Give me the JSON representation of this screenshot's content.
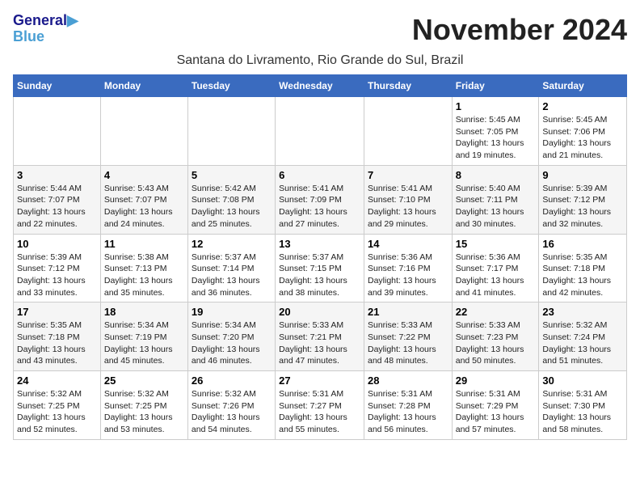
{
  "header": {
    "logo_line1": "General",
    "logo_line2": "Blue",
    "month_title": "November 2024",
    "location": "Santana do Livramento, Rio Grande do Sul, Brazil"
  },
  "weekdays": [
    "Sunday",
    "Monday",
    "Tuesday",
    "Wednesday",
    "Thursday",
    "Friday",
    "Saturday"
  ],
  "weeks": [
    [
      {
        "day": "",
        "info": ""
      },
      {
        "day": "",
        "info": ""
      },
      {
        "day": "",
        "info": ""
      },
      {
        "day": "",
        "info": ""
      },
      {
        "day": "",
        "info": ""
      },
      {
        "day": "1",
        "info": "Sunrise: 5:45 AM\nSunset: 7:05 PM\nDaylight: 13 hours\nand 19 minutes."
      },
      {
        "day": "2",
        "info": "Sunrise: 5:45 AM\nSunset: 7:06 PM\nDaylight: 13 hours\nand 21 minutes."
      }
    ],
    [
      {
        "day": "3",
        "info": "Sunrise: 5:44 AM\nSunset: 7:07 PM\nDaylight: 13 hours\nand 22 minutes."
      },
      {
        "day": "4",
        "info": "Sunrise: 5:43 AM\nSunset: 7:07 PM\nDaylight: 13 hours\nand 24 minutes."
      },
      {
        "day": "5",
        "info": "Sunrise: 5:42 AM\nSunset: 7:08 PM\nDaylight: 13 hours\nand 25 minutes."
      },
      {
        "day": "6",
        "info": "Sunrise: 5:41 AM\nSunset: 7:09 PM\nDaylight: 13 hours\nand 27 minutes."
      },
      {
        "day": "7",
        "info": "Sunrise: 5:41 AM\nSunset: 7:10 PM\nDaylight: 13 hours\nand 29 minutes."
      },
      {
        "day": "8",
        "info": "Sunrise: 5:40 AM\nSunset: 7:11 PM\nDaylight: 13 hours\nand 30 minutes."
      },
      {
        "day": "9",
        "info": "Sunrise: 5:39 AM\nSunset: 7:12 PM\nDaylight: 13 hours\nand 32 minutes."
      }
    ],
    [
      {
        "day": "10",
        "info": "Sunrise: 5:39 AM\nSunset: 7:12 PM\nDaylight: 13 hours\nand 33 minutes."
      },
      {
        "day": "11",
        "info": "Sunrise: 5:38 AM\nSunset: 7:13 PM\nDaylight: 13 hours\nand 35 minutes."
      },
      {
        "day": "12",
        "info": "Sunrise: 5:37 AM\nSunset: 7:14 PM\nDaylight: 13 hours\nand 36 minutes."
      },
      {
        "day": "13",
        "info": "Sunrise: 5:37 AM\nSunset: 7:15 PM\nDaylight: 13 hours\nand 38 minutes."
      },
      {
        "day": "14",
        "info": "Sunrise: 5:36 AM\nSunset: 7:16 PM\nDaylight: 13 hours\nand 39 minutes."
      },
      {
        "day": "15",
        "info": "Sunrise: 5:36 AM\nSunset: 7:17 PM\nDaylight: 13 hours\nand 41 minutes."
      },
      {
        "day": "16",
        "info": "Sunrise: 5:35 AM\nSunset: 7:18 PM\nDaylight: 13 hours\nand 42 minutes."
      }
    ],
    [
      {
        "day": "17",
        "info": "Sunrise: 5:35 AM\nSunset: 7:18 PM\nDaylight: 13 hours\nand 43 minutes."
      },
      {
        "day": "18",
        "info": "Sunrise: 5:34 AM\nSunset: 7:19 PM\nDaylight: 13 hours\nand 45 minutes."
      },
      {
        "day": "19",
        "info": "Sunrise: 5:34 AM\nSunset: 7:20 PM\nDaylight: 13 hours\nand 46 minutes."
      },
      {
        "day": "20",
        "info": "Sunrise: 5:33 AM\nSunset: 7:21 PM\nDaylight: 13 hours\nand 47 minutes."
      },
      {
        "day": "21",
        "info": "Sunrise: 5:33 AM\nSunset: 7:22 PM\nDaylight: 13 hours\nand 48 minutes."
      },
      {
        "day": "22",
        "info": "Sunrise: 5:33 AM\nSunset: 7:23 PM\nDaylight: 13 hours\nand 50 minutes."
      },
      {
        "day": "23",
        "info": "Sunrise: 5:32 AM\nSunset: 7:24 PM\nDaylight: 13 hours\nand 51 minutes."
      }
    ],
    [
      {
        "day": "24",
        "info": "Sunrise: 5:32 AM\nSunset: 7:25 PM\nDaylight: 13 hours\nand 52 minutes."
      },
      {
        "day": "25",
        "info": "Sunrise: 5:32 AM\nSunset: 7:25 PM\nDaylight: 13 hours\nand 53 minutes."
      },
      {
        "day": "26",
        "info": "Sunrise: 5:32 AM\nSunset: 7:26 PM\nDaylight: 13 hours\nand 54 minutes."
      },
      {
        "day": "27",
        "info": "Sunrise: 5:31 AM\nSunset: 7:27 PM\nDaylight: 13 hours\nand 55 minutes."
      },
      {
        "day": "28",
        "info": "Sunrise: 5:31 AM\nSunset: 7:28 PM\nDaylight: 13 hours\nand 56 minutes."
      },
      {
        "day": "29",
        "info": "Sunrise: 5:31 AM\nSunset: 7:29 PM\nDaylight: 13 hours\nand 57 minutes."
      },
      {
        "day": "30",
        "info": "Sunrise: 5:31 AM\nSunset: 7:30 PM\nDaylight: 13 hours\nand 58 minutes."
      }
    ]
  ]
}
